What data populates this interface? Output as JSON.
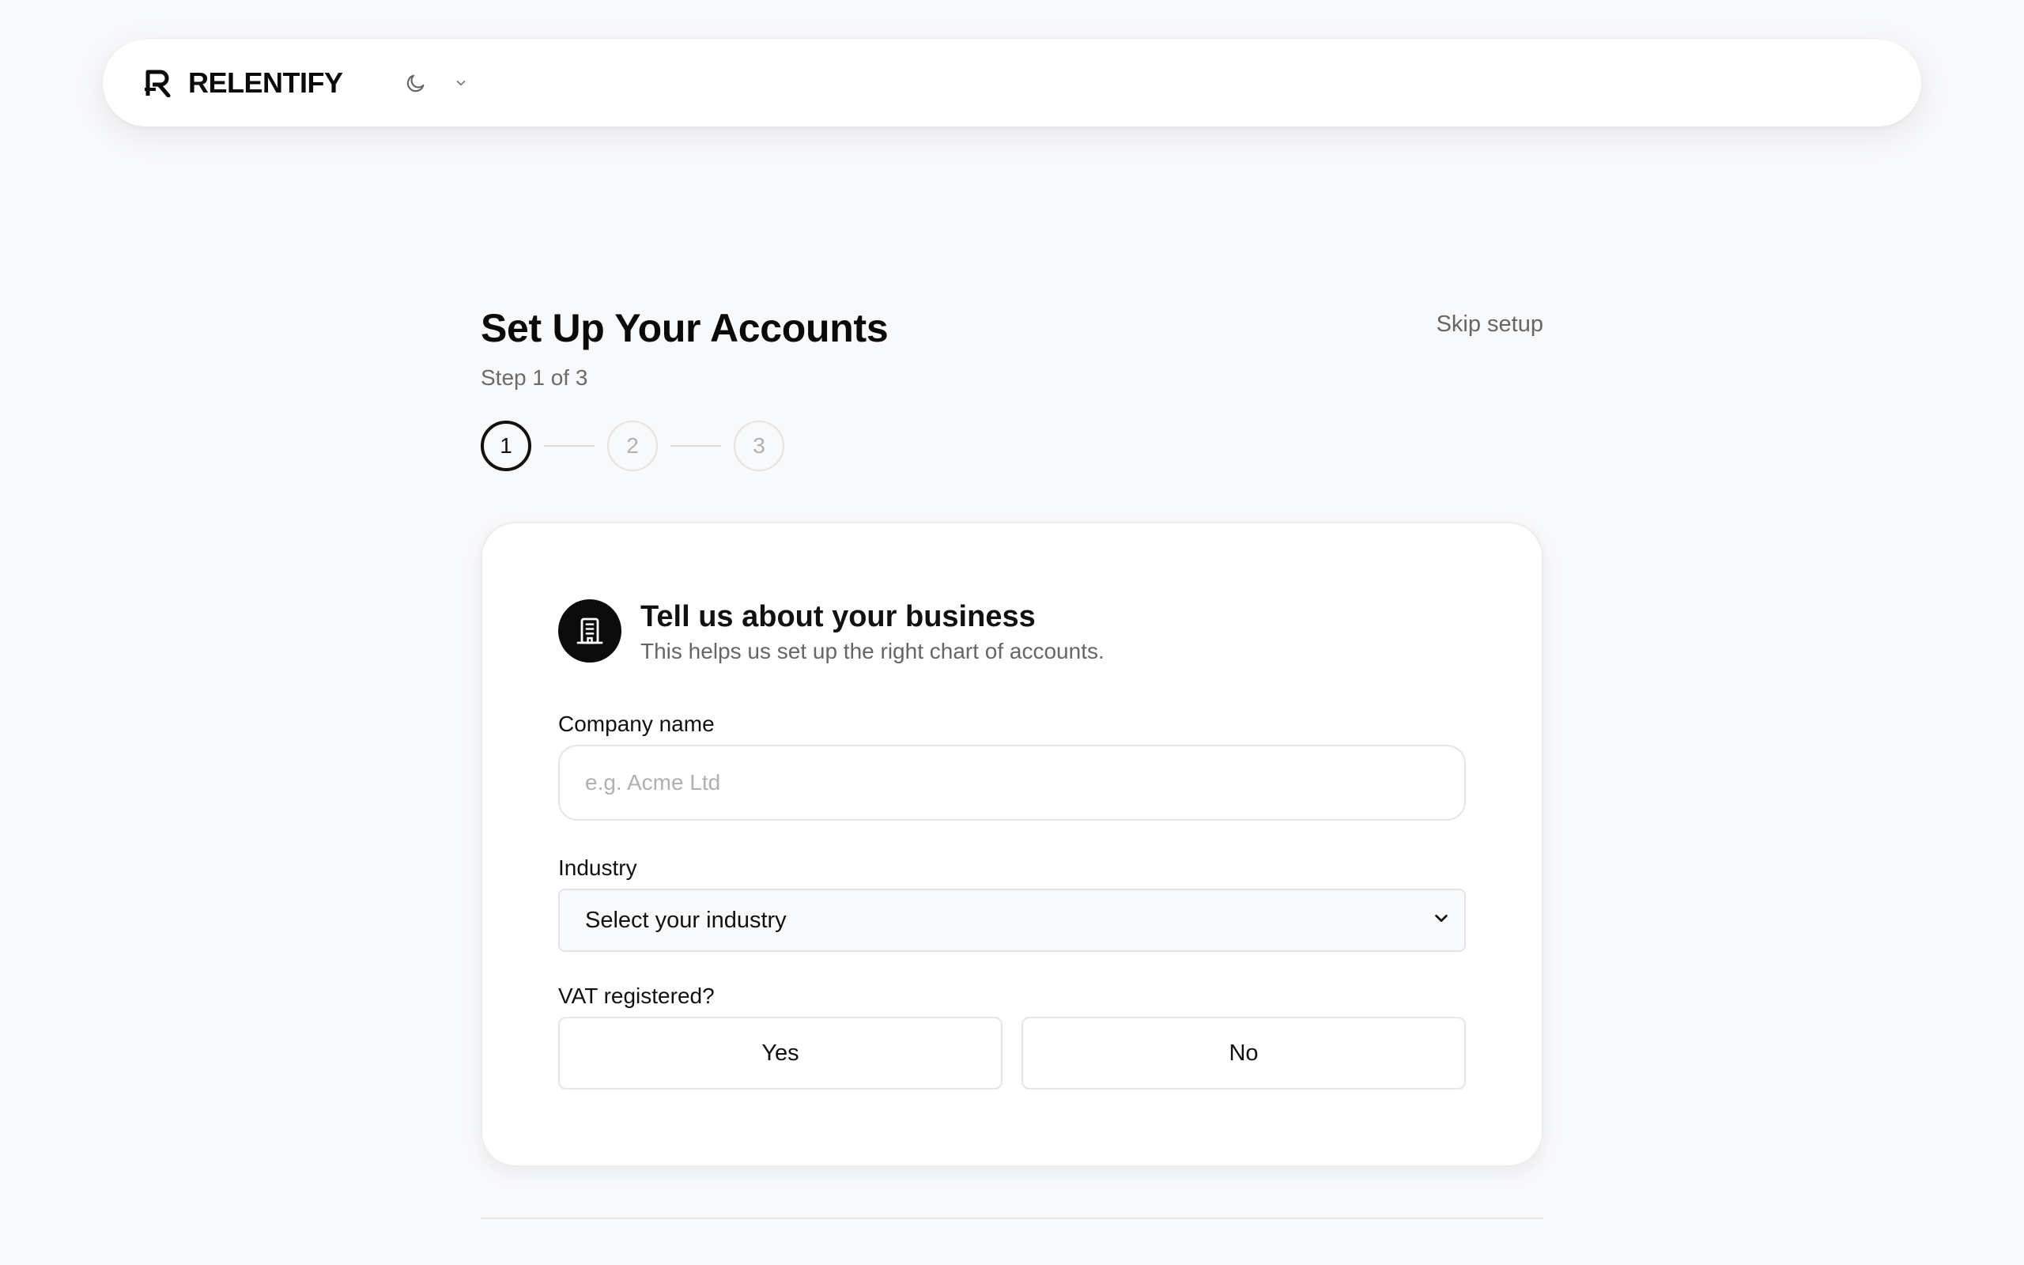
{
  "app": {
    "brand_name": "RELENTIFY",
    "logo_icon": "relentify-logo-icon",
    "theme_icon": "moon-icon",
    "theme_menu_icon": "chevron-down-icon"
  },
  "header": {
    "title": "Set Up Your Accounts",
    "step_text": "Step 1 of 3",
    "skip_label": "Skip setup"
  },
  "stepper": {
    "current": 1,
    "steps": [
      "1",
      "2",
      "3"
    ]
  },
  "card": {
    "icon": "building-icon",
    "title": "Tell us about your business",
    "subtitle": "This helps us set up the right chart of accounts.",
    "company": {
      "label": "Company name",
      "placeholder": "e.g. Acme Ltd",
      "value": ""
    },
    "industry": {
      "label": "Industry",
      "selected": "Select your industry"
    },
    "vat": {
      "label": "VAT registered?",
      "yes_label": "Yes",
      "no_label": "No"
    }
  },
  "colors": {
    "background": "#f8f9fb",
    "text": "#111111",
    "muted": "#666666",
    "accent": "#0b0b0b"
  }
}
